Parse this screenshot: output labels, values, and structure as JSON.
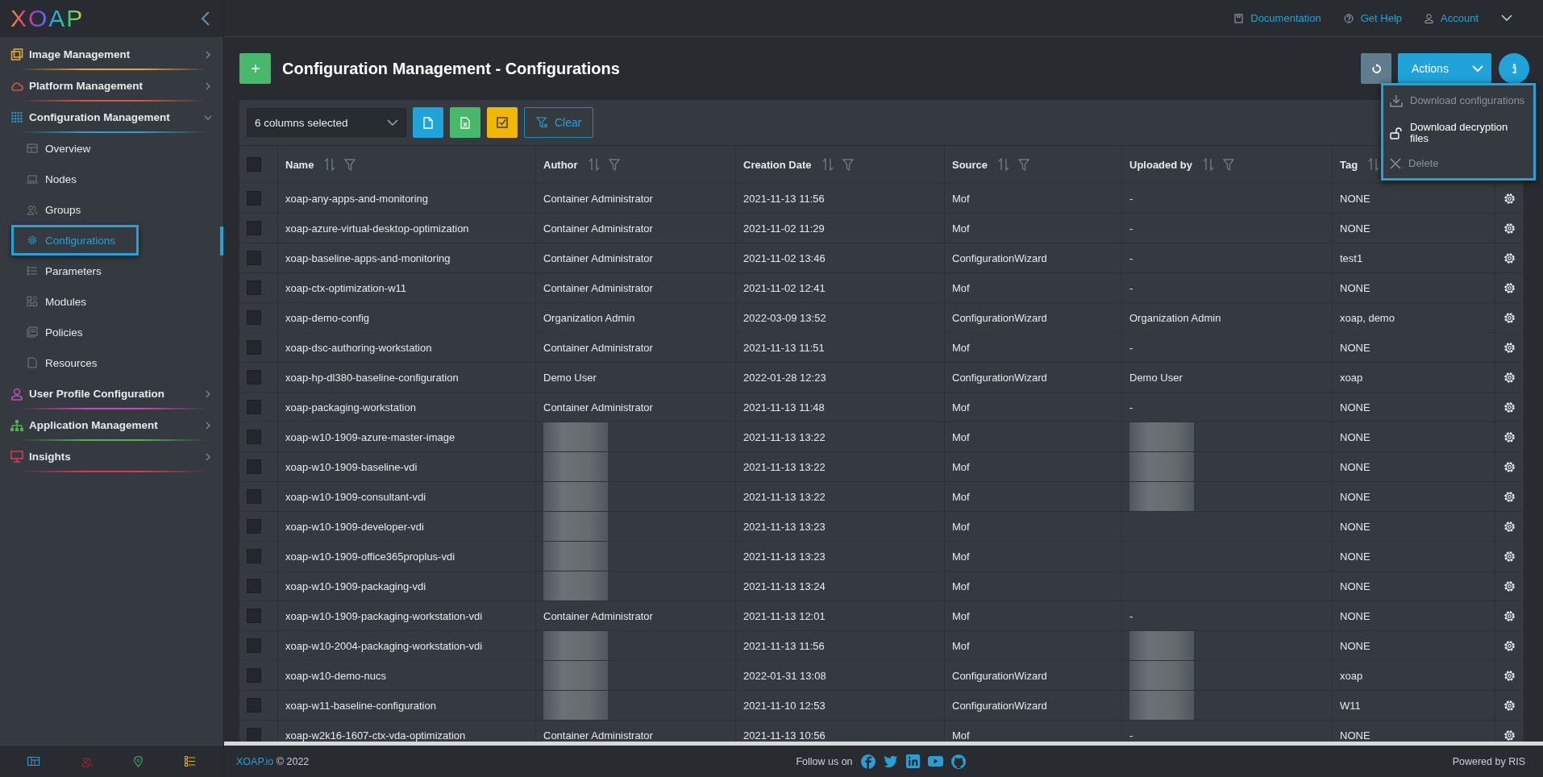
{
  "sidebar": {
    "logo": "XOAP",
    "sections": [
      {
        "label": "Image Management",
        "color": "#e8a33d",
        "expanded": false
      },
      {
        "label": "Platform Management",
        "color": "#e0533a",
        "expanded": false
      },
      {
        "label": "Configuration Management",
        "color": "#2a9fd6",
        "expanded": true,
        "children": [
          {
            "label": "Overview",
            "selected": false
          },
          {
            "label": "Nodes",
            "selected": false
          },
          {
            "label": "Groups",
            "selected": false
          },
          {
            "label": "Configurations",
            "selected": true
          },
          {
            "label": "Parameters",
            "selected": false
          },
          {
            "label": "Modules",
            "selected": false
          },
          {
            "label": "Policies",
            "selected": false
          },
          {
            "label": "Resources",
            "selected": false
          }
        ]
      },
      {
        "label": "User Profile Configuration",
        "color": "#c84bb0",
        "expanded": false
      },
      {
        "label": "Application Management",
        "color": "#4cb84c",
        "expanded": false
      },
      {
        "label": "Insights",
        "color": "#e0345f",
        "expanded": false
      }
    ]
  },
  "top_bar": {
    "links": [
      "Documentation",
      "Get Help",
      "Account"
    ]
  },
  "page": {
    "title": "Configuration Management - Configurations",
    "actions_button": "Actions"
  },
  "actions_menu": [
    {
      "label": "Download configurations",
      "disabled": true
    },
    {
      "label": "Download decryption files",
      "disabled": false
    },
    {
      "label": "Delete",
      "disabled": true
    }
  ],
  "toolbar": {
    "columns_select": "6 columns selected",
    "clear_button": "Clear"
  },
  "table": {
    "select_all_checked": false,
    "columns": [
      "Name",
      "Author",
      "Creation Date",
      "Source",
      "Uploaded by",
      "Tag"
    ],
    "rows": [
      {
        "checked": false,
        "name": "xoap-any-apps-and-monitoring",
        "author": "Container Administrator",
        "created": "2021-11-13 11:56",
        "source": "Mof",
        "uploaded_by": "-",
        "tag": "NONE"
      },
      {
        "checked": false,
        "name": "xoap-azure-virtual-desktop-optimization",
        "author": "Container Administrator",
        "created": "2021-11-02 11:29",
        "source": "Mof",
        "uploaded_by": "-",
        "tag": "NONE"
      },
      {
        "checked": false,
        "name": "xoap-baseline-apps-and-monitoring",
        "author": "Container Administrator",
        "created": "2021-11-02 13:46",
        "source": "ConfigurationWizard",
        "uploaded_by": "-",
        "tag": "test1"
      },
      {
        "checked": false,
        "name": "xoap-ctx-optimization-w11",
        "author": "Container Administrator",
        "created": "2021-11-02 12:41",
        "source": "Mof",
        "uploaded_by": "-",
        "tag": "NONE"
      },
      {
        "checked": false,
        "name": "xoap-demo-config",
        "author": "Organization Admin",
        "created": "2022-03-09 13:52",
        "source": "ConfigurationWizard",
        "uploaded_by": "Organization Admin",
        "tag": "xoap, demo"
      },
      {
        "checked": false,
        "name": "xoap-dsc-authoring-workstation",
        "author": "Container Administrator",
        "created": "2021-11-13 11:51",
        "source": "Mof",
        "uploaded_by": "-",
        "tag": "NONE"
      },
      {
        "checked": false,
        "name": "xoap-hp-dl380-baseline-configuration",
        "author": "Demo User",
        "created": "2022-01-28 12:23",
        "source": "ConfigurationWizard",
        "uploaded_by": "Demo User",
        "tag": "xoap"
      },
      {
        "checked": false,
        "name": "xoap-packaging-workstation",
        "author": "Container Administrator",
        "created": "2021-11-13 11:48",
        "source": "Mof",
        "uploaded_by": "-",
        "tag": "NONE"
      },
      {
        "checked": false,
        "name": "xoap-w10-1909-azure-master-image",
        "author_hidden": true,
        "created": "2021-11-13 13:22",
        "source": "Mof",
        "uploaded_by_hidden": true,
        "tag": "NONE"
      },
      {
        "checked": false,
        "name": "xoap-w10-1909-baseline-vdi",
        "author_hidden": true,
        "created": "2021-11-13 13:22",
        "source": "Mof",
        "uploaded_by_hidden": true,
        "tag": "NONE"
      },
      {
        "checked": false,
        "name": "xoap-w10-1909-consultant-vdi",
        "author_hidden": true,
        "created": "2021-11-13 13:22",
        "source": "Mof",
        "uploaded_by_hidden": true,
        "tag": "NONE"
      },
      {
        "checked": false,
        "name": "xoap-w10-1909-developer-vdi",
        "author_hidden": true,
        "created": "2021-11-13 13:23",
        "source": "Mof",
        "tag": "NONE"
      },
      {
        "checked": false,
        "name": "xoap-w10-1909-office365proplus-vdi",
        "author_hidden": true,
        "created": "2021-11-13 13:23",
        "source": "Mof",
        "tag": "NONE"
      },
      {
        "checked": false,
        "name": "xoap-w10-1909-packaging-vdi",
        "author_hidden": true,
        "created": "2021-11-13 13:24",
        "source": "Mof",
        "tag": "NONE"
      },
      {
        "checked": false,
        "name": "xoap-w10-1909-packaging-workstation-vdi",
        "author": "Container Administrator",
        "created": "2021-11-13 12:01",
        "source": "Mof",
        "uploaded_by": "-",
        "tag": "NONE"
      },
      {
        "checked": false,
        "name": "xoap-w10-2004-packaging-workstation-vdi",
        "author_hidden": true,
        "created": "2021-11-13 11:56",
        "source": "Mof",
        "uploaded_by_hidden": true,
        "tag": "NONE"
      },
      {
        "checked": false,
        "name": "xoap-w10-demo-nucs",
        "author_hidden": true,
        "created": "2022-01-31 13:08",
        "source": "ConfigurationWizard",
        "uploaded_by_hidden": true,
        "tag": "xoap"
      },
      {
        "checked": false,
        "name": "xoap-w11-baseline-configuration",
        "author_hidden": true,
        "created": "2021-11-10 12:53",
        "source": "ConfigurationWizard",
        "uploaded_by_hidden": true,
        "tag": "W11"
      },
      {
        "checked": false,
        "name": "xoap-w2k16-1607-ctx-vda-optimization",
        "author": "Container Administrator",
        "created": "2021-11-13 10:56",
        "source": "Mof",
        "uploaded_by": "-",
        "tag": "NONE"
      }
    ]
  },
  "footer": {
    "site_link": "XOAP.io",
    "copyright": "© 2022",
    "follow": "Follow us on",
    "powered": "Powered by RIS"
  }
}
